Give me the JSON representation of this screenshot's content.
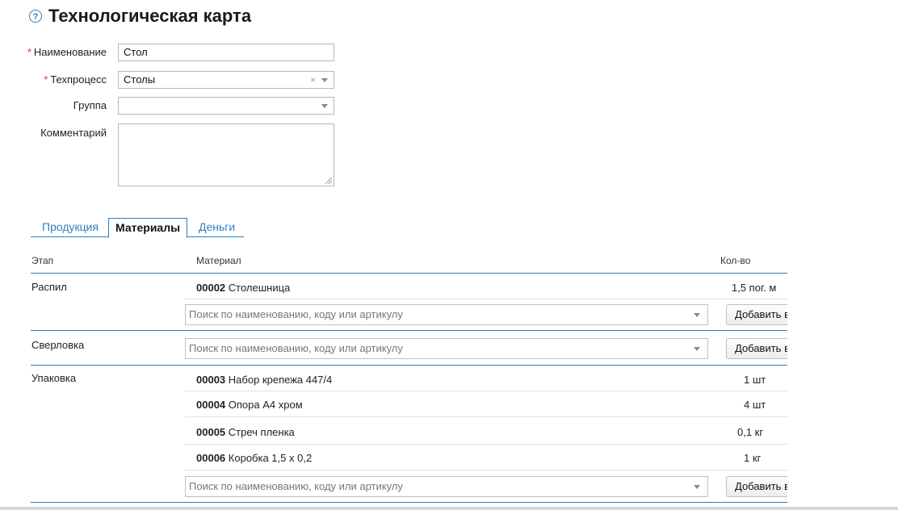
{
  "header": {
    "help_icon": "?",
    "title": "Технологическая карта"
  },
  "form": {
    "required_mark": "*",
    "name_label": "Наименование",
    "name_value": "Стол",
    "process_label": "Техпроцесс",
    "process_value": "Столы",
    "process_clear": "×",
    "group_label": "Группа",
    "group_value": "",
    "comment_label": "Комментарий",
    "comment_value": ""
  },
  "tabs": [
    {
      "label": "Продукция",
      "active": false
    },
    {
      "label": "Материалы",
      "active": true
    },
    {
      "label": "Деньги",
      "active": false
    }
  ],
  "table": {
    "col_stage": "Этап",
    "col_material": "Материал",
    "col_qty": "Кол-во",
    "search_placeholder": "Поиск по наименованию, коду или артикулу",
    "add_label": "Добавить в",
    "stages": [
      {
        "name": "Распил",
        "materials": [
          {
            "code": "00002",
            "name": "Столешница",
            "qty": "1,5  пог. м"
          }
        ]
      },
      {
        "name": "Сверловка",
        "materials": []
      },
      {
        "name": "Упаковка",
        "materials": [
          {
            "code": "00003",
            "name": "Набор крепежа 447/4",
            "qty": "1  шт"
          },
          {
            "code": "00004",
            "name": "Опора А4 хром",
            "qty": "4  шт"
          },
          {
            "code": "00005",
            "name": "Стреч пленка",
            "qty": "0,1  кг"
          },
          {
            "code": "00006",
            "name": "Коробка 1,5 х 0,2",
            "qty": "1  кг"
          }
        ]
      }
    ]
  },
  "colors": {
    "accent": "#2f7fc1",
    "required": "#d9302c"
  }
}
